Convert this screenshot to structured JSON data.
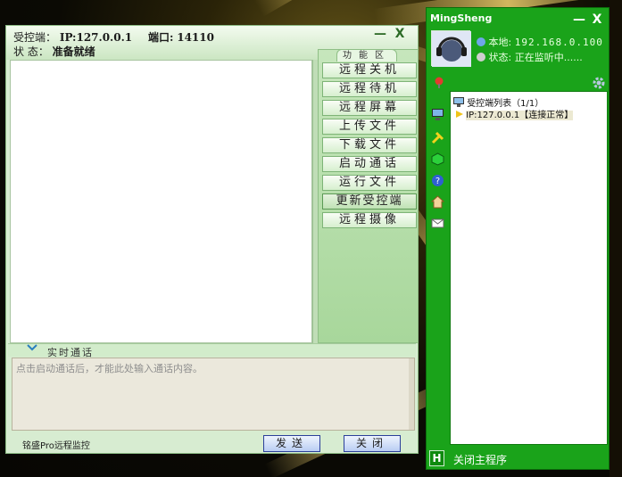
{
  "main_window": {
    "ip_label": "受控端：",
    "ip_value": "IP:127.0.0.1",
    "port_label": "端口:",
    "port_value": "14110",
    "status_label": "状  态：",
    "status_value": "准备就绪",
    "minimize_glyph": "—",
    "close_glyph": "X",
    "function_area_title": "功能区",
    "functions": [
      "远程关机",
      "远程待机",
      "远程屏幕",
      "上传文件",
      "下载文件",
      "启动通话",
      "运行文件",
      "更新受控端",
      "远程摄像"
    ],
    "chat_title": "实时通话",
    "chat_placeholder": "点击启动通话后，才能此处输入通话内容。",
    "bottom_status": "铭盛Pro远程监控",
    "send_button": "发送",
    "close_button": "关闭"
  },
  "side_window": {
    "title": "MingSheng",
    "minimize_glyph": "—",
    "close_glyph": "X",
    "local_label": "本地:",
    "local_ip": "192.168.0.100",
    "state_label": "状态:",
    "state_value": "正在监听中......",
    "tree_root": "受控端列表（1/1）",
    "tree_item": "IP:127.0.0.1【连接正常】",
    "exit_glyph": "H",
    "exit_label": "关闭主程序"
  },
  "colors": {
    "side_green": "#1aa31a",
    "panel_green": "#a8d79b",
    "button_blue": "#b9cdf3"
  }
}
